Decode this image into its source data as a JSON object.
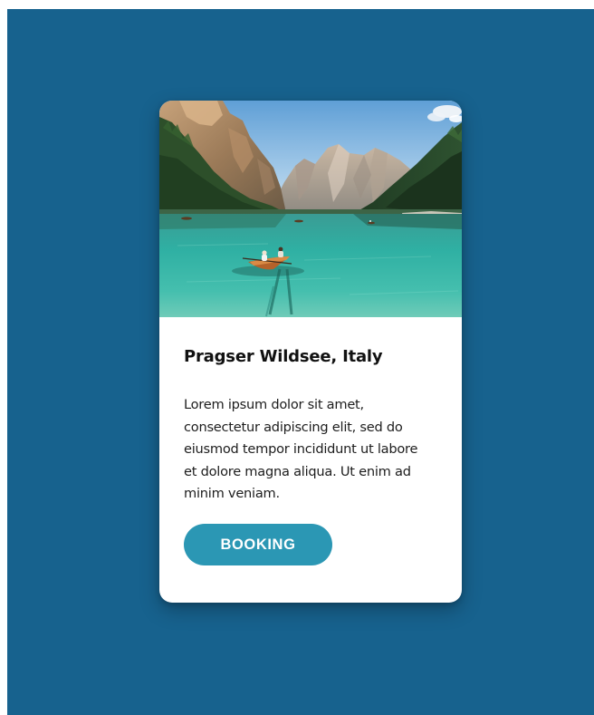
{
  "card": {
    "image_alt": "Lake with rowing boat surrounded by mountains",
    "title": "Pragser Wildsee, Italy",
    "description": "Lorem ipsum dolor sit amet, consectetur adipiscing elit, sed do eiusmod tempor incididunt ut labore et dolore magna aliqua. Ut enim ad minim veniam.",
    "button_label": "BOOKING"
  },
  "colors": {
    "page_background": "#17628e",
    "card_background": "#ffffff",
    "button": "#2b97b4",
    "button_text": "#ffffff",
    "title_text": "#111111"
  }
}
